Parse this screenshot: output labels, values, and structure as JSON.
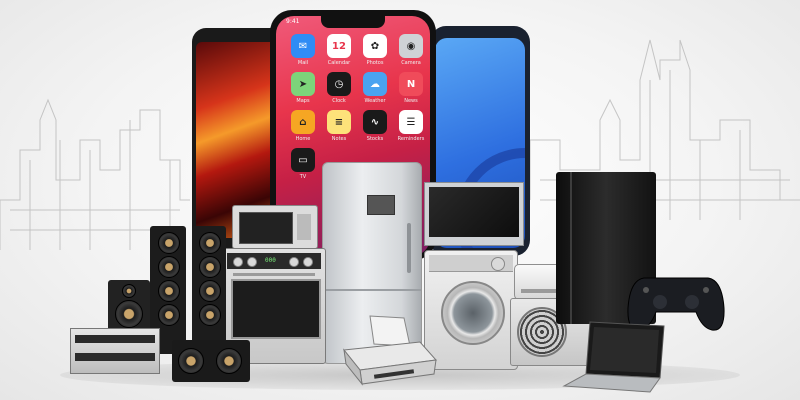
{
  "scene": {
    "background": "#f4f4f4",
    "accent_colors": {
      "phone_red": "#e8354c",
      "phone_blue": "#3d84e8",
      "steel": "#d8dadc",
      "black": "#1a1a1a"
    }
  },
  "phone_center": {
    "status_time": "9:41",
    "calendar_date": "12",
    "apps": [
      {
        "label": "Mail",
        "icon": "mail-icon",
        "color": "#2f8cf5",
        "glyph": "✉"
      },
      {
        "label": "Calendar",
        "icon": "calendar-icon",
        "color": "#ffffff",
        "glyph": "12"
      },
      {
        "label": "Photos",
        "icon": "photos-icon",
        "color": "#ffffff",
        "glyph": "✿"
      },
      {
        "label": "Camera",
        "icon": "camera-icon",
        "color": "#cfd2d6",
        "glyph": "◉"
      },
      {
        "label": "Maps",
        "icon": "maps-icon",
        "color": "#7dd47a",
        "glyph": "➤"
      },
      {
        "label": "Clock",
        "icon": "clock-icon",
        "color": "#1a1a1a",
        "glyph": "◷"
      },
      {
        "label": "Weather",
        "icon": "weather-icon",
        "color": "#4aa3f0",
        "glyph": "☁"
      },
      {
        "label": "News",
        "icon": "news-icon",
        "color": "#f04b5a",
        "glyph": "N"
      },
      {
        "label": "Home",
        "icon": "home-icon",
        "color": "#f6a623",
        "glyph": "⌂"
      },
      {
        "label": "Notes",
        "icon": "notes-icon",
        "color": "#fde27a",
        "glyph": "≡"
      },
      {
        "label": "Stocks",
        "icon": "stocks-icon",
        "color": "#1a1a1a",
        "glyph": "∿"
      },
      {
        "label": "Reminders",
        "icon": "reminders-icon",
        "color": "#ffffff",
        "glyph": "☰"
      },
      {
        "label": "TV",
        "icon": "tv-icon",
        "color": "#1a1a1a",
        "glyph": "▭"
      }
    ]
  },
  "stove_display": "000"
}
